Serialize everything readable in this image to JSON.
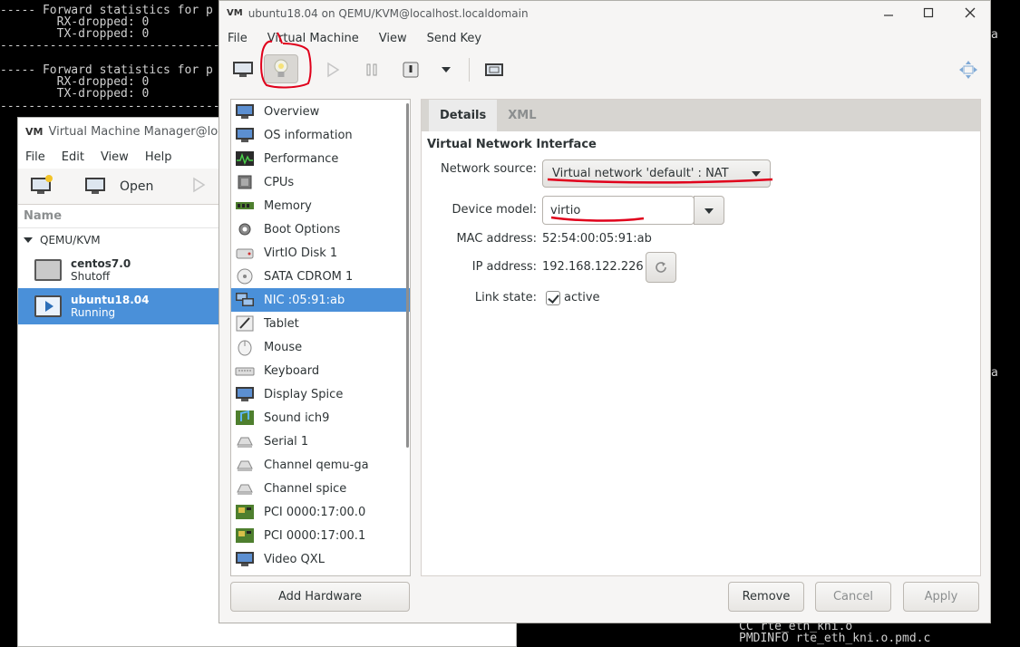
{
  "terminal": {
    "lines": [
      "----- Forward statistics for p",
      "        RX-dropped: 0",
      "        TX-dropped: 0",
      "-------------------------------",
      "",
      "----- Forward statistics for p",
      "        RX-dropped: 0",
      "        TX-dropped: 0",
      "-------------------------------"
    ],
    "right_fragments": [
      "a",
      "a"
    ],
    "bottom_lines": [
      "CC rte_eth_kni.o",
      "PMDINFO rte_eth_kni.o.pmd.c"
    ]
  },
  "manager": {
    "title": "Virtual Machine Manager@localhost",
    "menu": [
      "File",
      "Edit",
      "View",
      "Help"
    ],
    "toolbar": {
      "open_label": "Open"
    },
    "column_header": "Name",
    "group": "QEMU/KVM",
    "vms": [
      {
        "name": "centos7.0",
        "status": "Shutoff"
      },
      {
        "name": "ubuntu18.04",
        "status": "Running"
      }
    ]
  },
  "vm_window": {
    "title": "ubuntu18.04 on QEMU/KVM@localhost.localdomain",
    "menu": [
      "File",
      "Virtual Machine",
      "View",
      "Send Key"
    ],
    "hardware": [
      {
        "label": "Overview",
        "icon": "monitor-icon"
      },
      {
        "label": "OS information",
        "icon": "monitor-icon"
      },
      {
        "label": "Performance",
        "icon": "performance-icon"
      },
      {
        "label": "CPUs",
        "icon": "cpu-icon"
      },
      {
        "label": "Memory",
        "icon": "memory-icon"
      },
      {
        "label": "Boot Options",
        "icon": "gear-icon"
      },
      {
        "label": "VirtIO Disk 1",
        "icon": "disk-icon"
      },
      {
        "label": "SATA CDROM 1",
        "icon": "cdrom-icon"
      },
      {
        "label": "NIC :05:91:ab",
        "icon": "network-icon"
      },
      {
        "label": "Tablet",
        "icon": "tablet-icon"
      },
      {
        "label": "Mouse",
        "icon": "mouse-icon"
      },
      {
        "label": "Keyboard",
        "icon": "keyboard-icon"
      },
      {
        "label": "Display Spice",
        "icon": "monitor-icon"
      },
      {
        "label": "Sound ich9",
        "icon": "sound-icon"
      },
      {
        "label": "Serial 1",
        "icon": "serial-icon"
      },
      {
        "label": "Channel qemu-ga",
        "icon": "serial-icon"
      },
      {
        "label": "Channel spice",
        "icon": "serial-icon"
      },
      {
        "label": "PCI 0000:17:00.0",
        "icon": "pci-icon"
      },
      {
        "label": "PCI 0000:17:00.1",
        "icon": "pci-icon"
      },
      {
        "label": "Video QXL",
        "icon": "monitor-icon"
      }
    ],
    "add_hardware": "Add Hardware",
    "tabs": [
      "Details",
      "XML"
    ],
    "details": {
      "section": "Virtual Network Interface",
      "network_source_label": "Network source:",
      "network_source_value": "Virtual network 'default' : NAT",
      "device_model_label": "Device model:",
      "device_model_value": "virtio",
      "mac_label": "MAC address:",
      "mac_value": "52:54:00:05:91:ab",
      "ip_label": "IP address:",
      "ip_value": "192.168.122.226",
      "link_label": "Link state:",
      "link_value": "active"
    },
    "buttons": {
      "remove": "Remove",
      "cancel": "Cancel",
      "apply": "Apply"
    }
  },
  "colors": {
    "selection": "#4a90d9",
    "annotation": "#e0001b"
  }
}
